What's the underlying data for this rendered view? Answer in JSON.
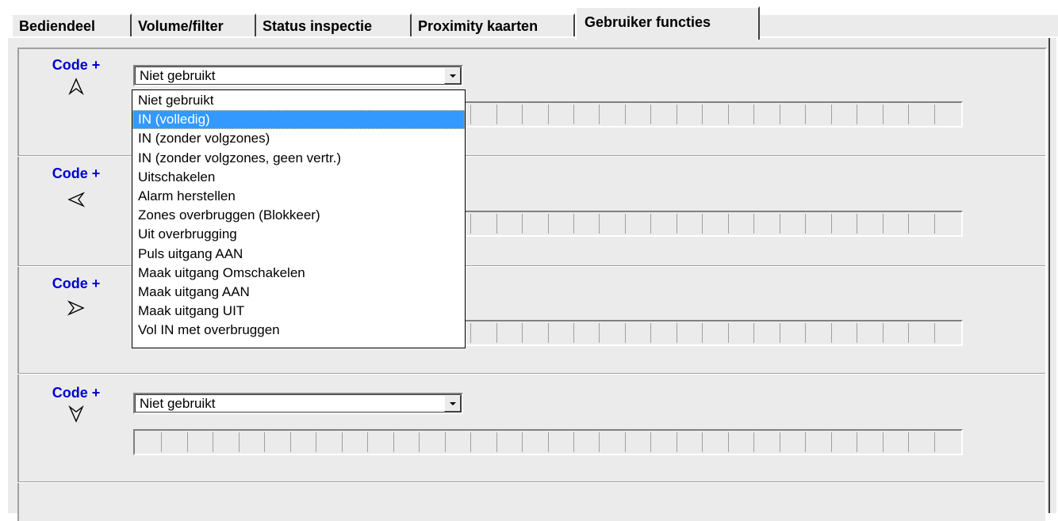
{
  "tabs": [
    {
      "label": "Bediendeel",
      "active": false
    },
    {
      "label": "Volume/filter",
      "active": false
    },
    {
      "label": "Status inspectie",
      "active": false
    },
    {
      "label": "Proximity kaarten",
      "active": false
    },
    {
      "label": "Gebruiker functies",
      "active": true
    }
  ],
  "sections": [
    {
      "label": "Code +",
      "arrow_icon": "arrow-up-icon",
      "combo_value": "Niet gebruikt"
    },
    {
      "label": "Code +",
      "arrow_icon": "arrow-left-icon",
      "combo_value": ""
    },
    {
      "label": "Code +",
      "arrow_icon": "arrow-right-icon",
      "combo_value": ""
    },
    {
      "label": "Code +",
      "arrow_icon": "arrow-down-icon",
      "combo_value": "Niet gebruikt"
    }
  ],
  "dropdown": {
    "open": true,
    "selected_index": 1,
    "options": [
      "Niet gebruikt",
      "IN (volledig)",
      "IN (zonder volgzones)",
      "IN (zonder volgzones, geen vertr.)",
      "Uitschakelen",
      "Alarm herstellen",
      "Zones overbruggen (Blokkeer)",
      "Uit overbrugging",
      "Puls uitgang AAN",
      "Maak uitgang Omschakelen",
      "Maak uitgang AAN",
      "Maak uitgang UIT",
      "Vol IN met overbruggen"
    ]
  },
  "colors": {
    "code_label": "#0000d0",
    "selection": "#3399ff",
    "panel_bg": "#ebebeb"
  }
}
